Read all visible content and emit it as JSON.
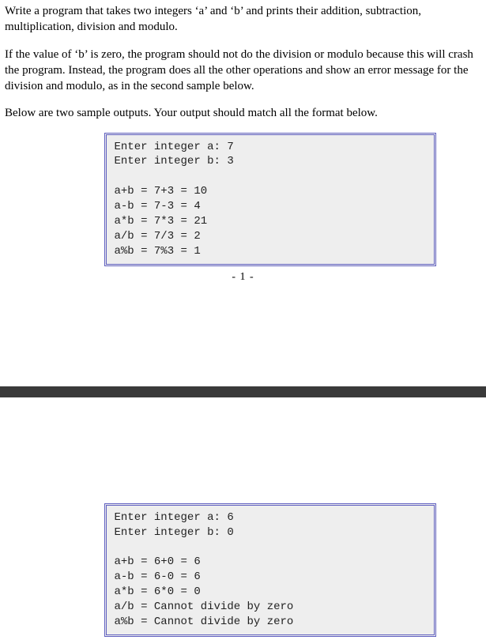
{
  "paragraphs": {
    "p1": "Write a program that takes two integers ‘a’ and ‘b’ and prints their addition, subtraction, multiplication, division and modulo.",
    "p2": "If the value of ‘b’ is zero, the program should not do the division or modulo because this will crash the program. Instead, the program does all the other operations and show an error message for the division and modulo, as in the second sample below.",
    "p3": "Below are two sample outputs. Your output should match all the format below."
  },
  "sample1": {
    "l1": "Enter integer a: 7",
    "l2": "Enter integer b: 3",
    "l3": "",
    "l4": "a+b = 7+3 = 10",
    "l5": "a-b = 7-3 = 4",
    "l6": "a*b = 7*3 = 21",
    "l7": "a/b = 7/3 = 2",
    "l8": "a%b = 7%3 = 1"
  },
  "page_footer": "- 1 -",
  "sample2": {
    "l1": "Enter integer a: 6",
    "l2": "Enter integer b: 0",
    "l3": "",
    "l4": "a+b = 6+0 = 6",
    "l5": "a-b = 6-0 = 6",
    "l6": "a*b = 6*0 = 0",
    "l7": "a/b = Cannot divide by zero",
    "l8": "a%b = Cannot divide by zero"
  }
}
